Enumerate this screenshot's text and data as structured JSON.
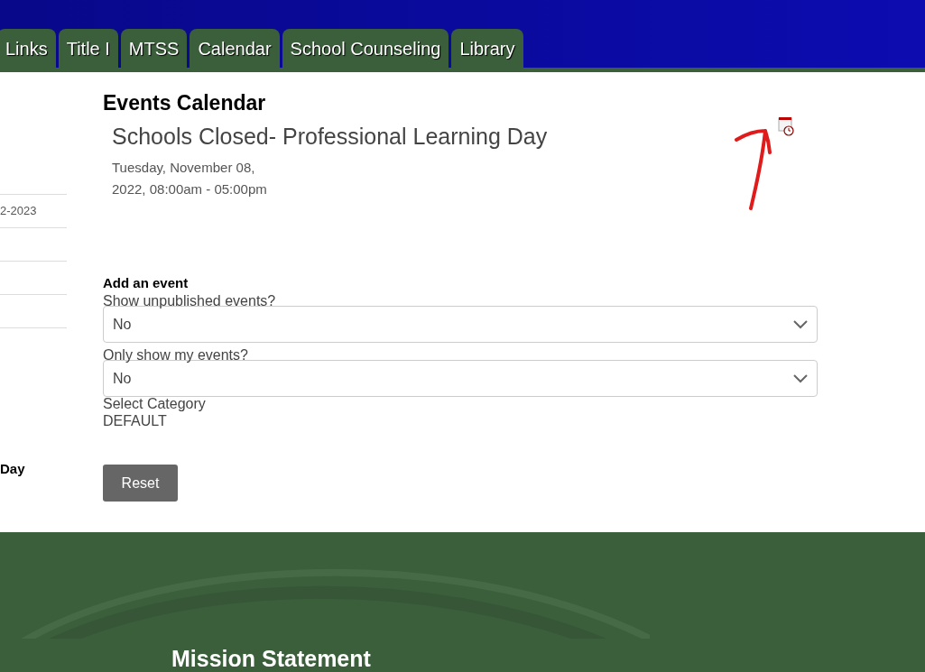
{
  "nav_tabs": [
    {
      "label": "Links"
    },
    {
      "label": "Title I"
    },
    {
      "label": "MTSS"
    },
    {
      "label": "Calendar"
    },
    {
      "label": "School Counseling"
    },
    {
      "label": "Library"
    }
  ],
  "sidebar": {
    "items": [
      "2-2023"
    ],
    "event_title": "Day"
  },
  "main": {
    "heading": "Events Calendar",
    "event": {
      "title": "Schools Closed- Professional Learning Day",
      "date_line_1": "Tuesday, November 08,",
      "date_line_2": "2022, 08:00am - 05:00pm"
    },
    "add_event": "Add an event",
    "filters": [
      {
        "label": "Show unpublished events?",
        "value": "No"
      },
      {
        "label": "Only show my events?",
        "value": "No"
      }
    ],
    "category_label": "Select Category",
    "category_value": "DEFAULT",
    "reset_button": "Reset"
  },
  "footer": {
    "heading": "Mission Statement"
  }
}
